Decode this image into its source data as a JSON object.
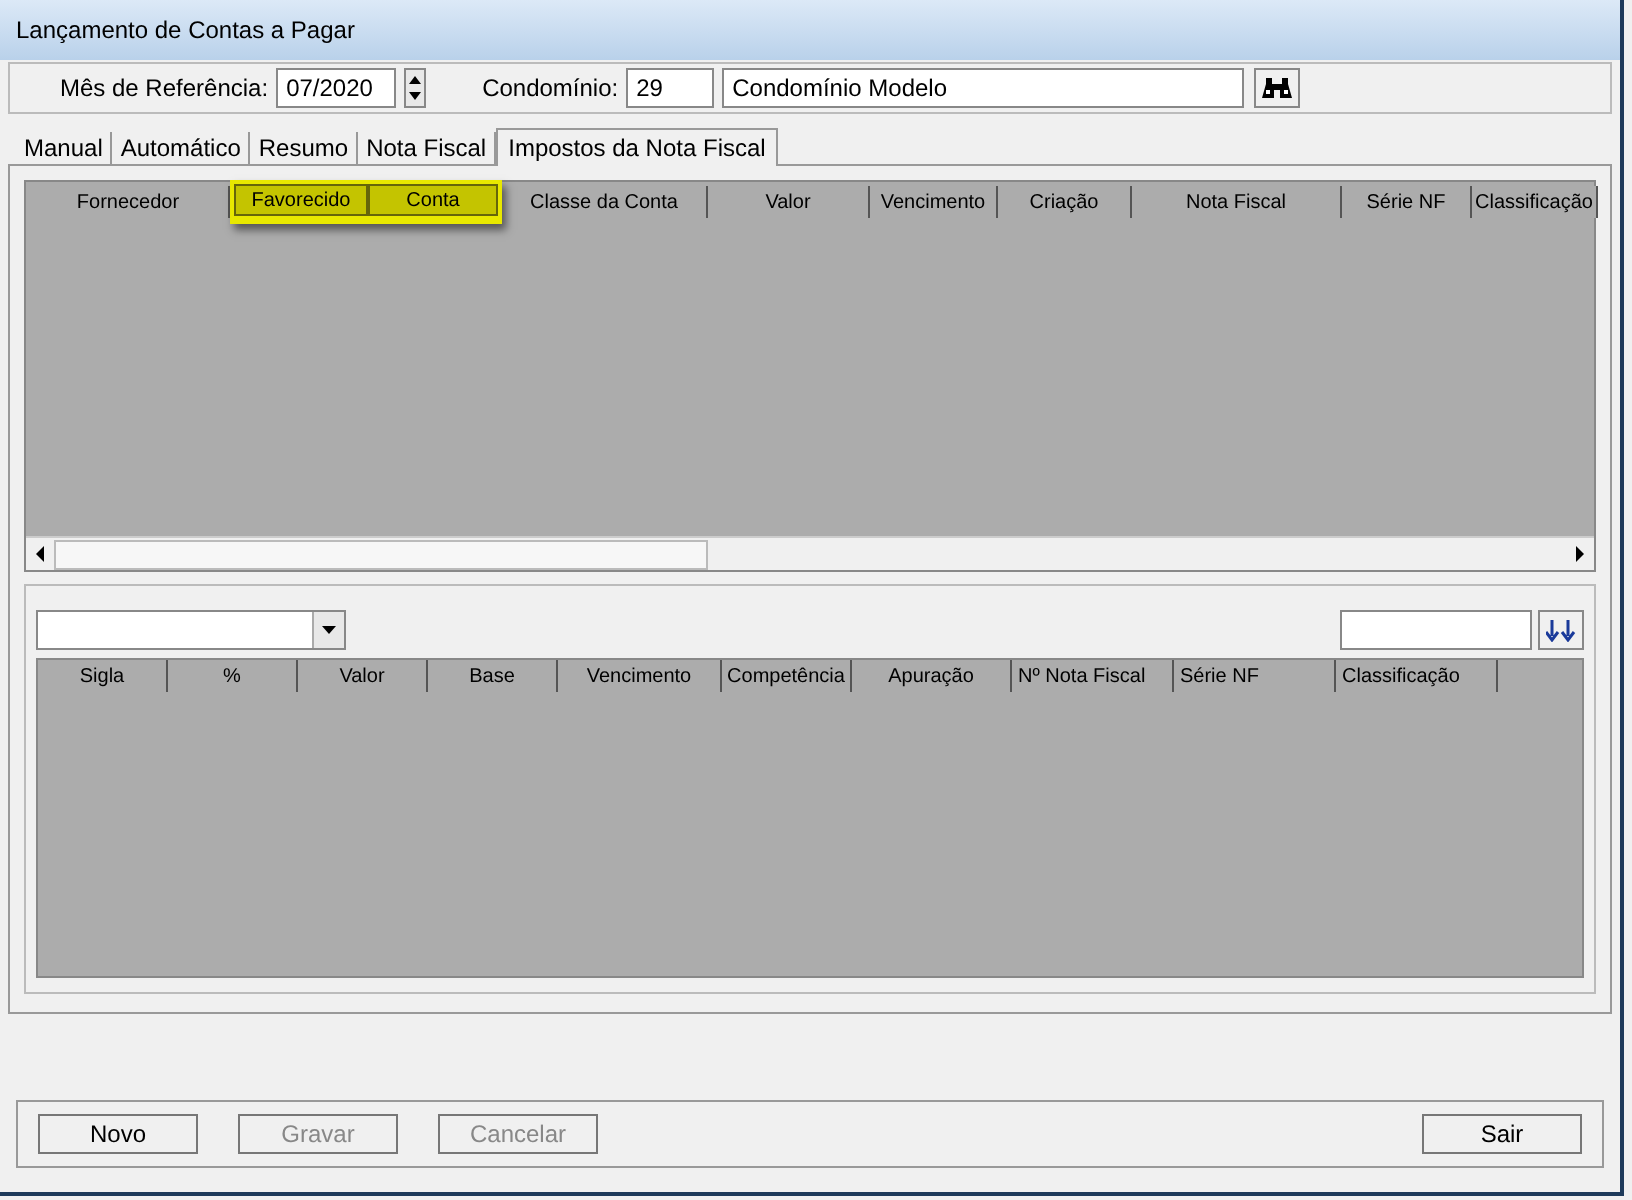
{
  "window": {
    "title": "Lançamento de Contas a Pagar"
  },
  "header": {
    "month_label": "Mês de Referência:",
    "month_value": "07/2020",
    "condo_label": "Condomínio:",
    "condo_code": "29",
    "condo_name": "Condomínio Modelo"
  },
  "tabs": [
    {
      "label": "Manual",
      "selected": false
    },
    {
      "label": "Automático",
      "selected": false
    },
    {
      "label": "Resumo",
      "selected": false
    },
    {
      "label": "Nota Fiscal",
      "selected": false
    },
    {
      "label": "Impostos da Nota Fiscal",
      "selected": true
    }
  ],
  "upper_table": {
    "columns": [
      {
        "label": "Fornecedor",
        "highlighted": false
      },
      {
        "label": "Favorecido",
        "highlighted": true
      },
      {
        "label": "Conta",
        "highlighted": true
      },
      {
        "label": "Classe da Conta",
        "highlighted": false
      },
      {
        "label": "Valor",
        "highlighted": false
      },
      {
        "label": "Vencimento",
        "highlighted": false
      },
      {
        "label": "Criação",
        "highlighted": false
      },
      {
        "label": "Nota Fiscal",
        "highlighted": false
      },
      {
        "label": "Série NF",
        "highlighted": false
      },
      {
        "label": "Classificação",
        "highlighted": false
      }
    ]
  },
  "lower_table": {
    "columns": [
      "Sigla",
      "%",
      "Valor",
      "Base",
      "Vencimento",
      "Competência",
      "Apuração",
      "Nº Nota Fiscal",
      "Série NF",
      "Classificação"
    ]
  },
  "buttons": [
    {
      "label": "Novo",
      "disabled": false
    },
    {
      "label": "Gravar",
      "disabled": true
    },
    {
      "label": "Cancelar",
      "disabled": true
    },
    {
      "label": "Sair",
      "disabled": false
    }
  ]
}
